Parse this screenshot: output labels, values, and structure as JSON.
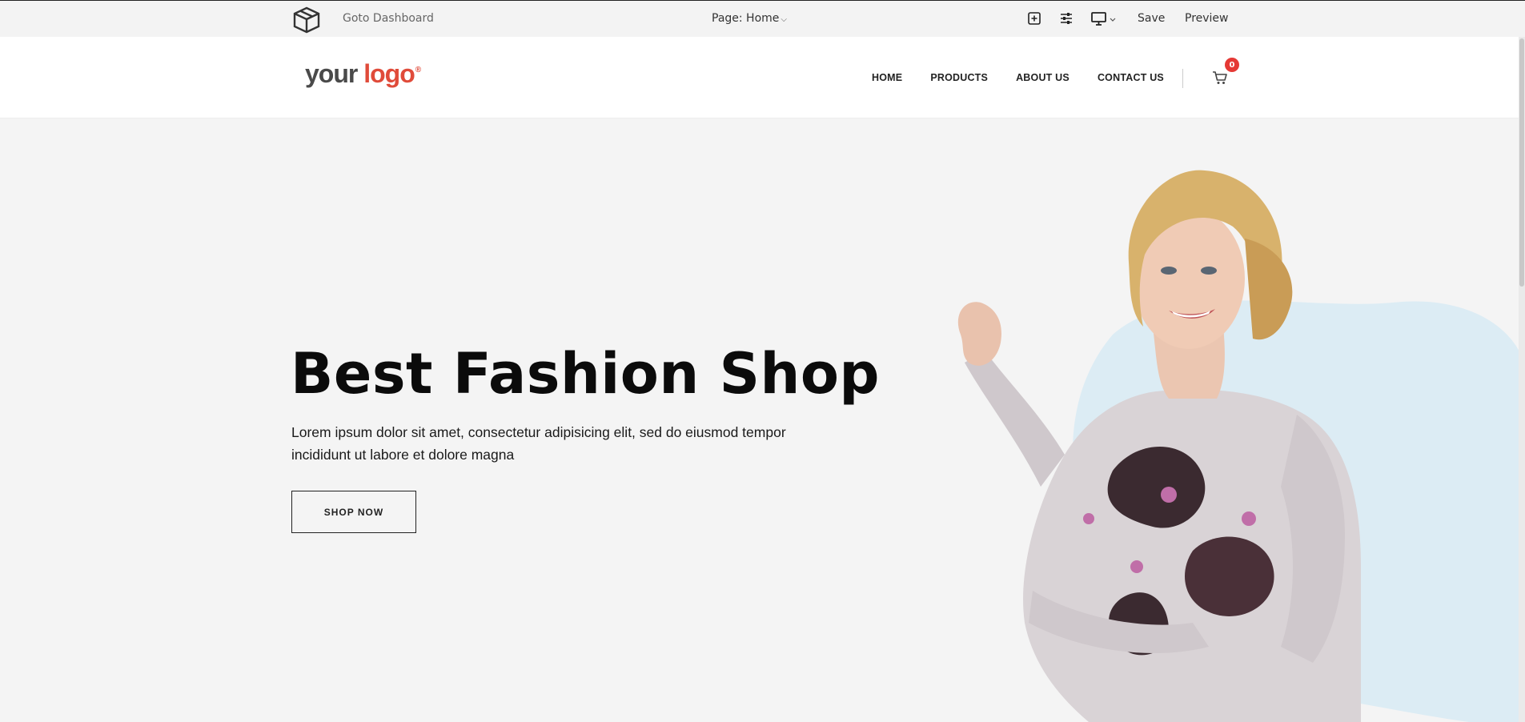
{
  "builder": {
    "dashboard_label": "Goto Dashboard",
    "page_selector": "Page: Home",
    "save_label": "Save",
    "preview_label": "Preview",
    "icons": [
      "box-logo-icon",
      "add-section-icon",
      "sliders-icon",
      "desktop-device-icon",
      "chevron-down-icon"
    ]
  },
  "header": {
    "logo_word1": "your",
    "logo_word2": "logo",
    "logo_mark": "®",
    "nav": [
      "HOME",
      "PRODUCTS",
      "ABOUT US",
      "CONTACT US"
    ],
    "cart_count": "0"
  },
  "hero": {
    "title": "Best Fashion Shop",
    "text": "Lorem ipsum dolor sit amet, consectetur adipisicing elit, sed do eiusmod tempor incididunt ut labore et dolore magna",
    "button_label": "SHOP NOW"
  },
  "colors": {
    "accent": "#e04b3a",
    "badge": "#e53935",
    "blob": "#dcecf4",
    "hero_bg": "#f4f4f4"
  }
}
